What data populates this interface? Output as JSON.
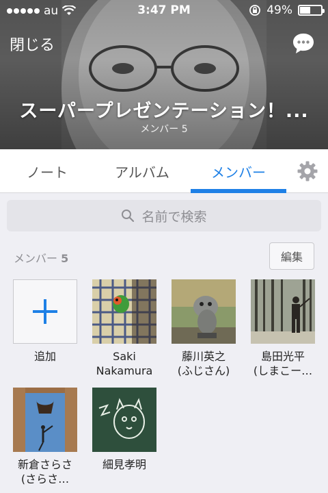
{
  "status_bar": {
    "carrier": "au",
    "time": "3:47 PM",
    "battery": "49%",
    "battery_level": 0.49
  },
  "header": {
    "close_label": "閉じる",
    "chat_icon": "chat-bubble-icon",
    "title": "スーパープレゼンテーション！...",
    "member_count_label": "メンバー 5"
  },
  "tabs": [
    {
      "label": "ノート"
    },
    {
      "label": "アルバム"
    },
    {
      "label": "メンバー",
      "active": true
    }
  ],
  "search": {
    "placeholder": "名前で検索"
  },
  "members_section": {
    "label": "メンバー",
    "count": "5",
    "edit_label": "編集"
  },
  "members": [
    {
      "name": "追加",
      "type": "add"
    },
    {
      "name": "Saki\nNakamura"
    },
    {
      "name": "藤川英之\n(ふじさん)"
    },
    {
      "name": "島田光平\n(しまこー…"
    },
    {
      "name": "新倉さらさ\n(さらさ…"
    },
    {
      "name": "細見孝明"
    }
  ],
  "colors": {
    "accent": "#1e80e6",
    "background": "#efeff4"
  }
}
